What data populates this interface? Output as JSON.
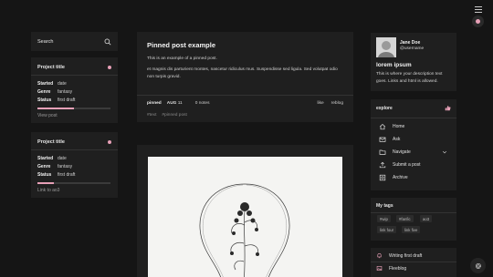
{
  "search": {
    "label": "Search"
  },
  "wips": [
    {
      "title": "Project title",
      "rows": [
        {
          "key": "Started",
          "value": "date"
        },
        {
          "key": "Genre",
          "value": "fantasy"
        },
        {
          "key": "Status",
          "value": "first draft"
        }
      ],
      "progress": 0.5,
      "link": "View post"
    },
    {
      "title": "Project title",
      "rows": [
        {
          "key": "Started",
          "value": "date"
        },
        {
          "key": "Genre",
          "value": "fantasy"
        },
        {
          "key": "Status",
          "value": "first draft"
        }
      ],
      "progress": 0.22,
      "link": "Link to ao3"
    }
  ],
  "post": {
    "title": "Pinned post example",
    "paragraph1": "This is an example of a pinned post.",
    "paragraph2": "et magnis dis parturient montes, nascetur ridiculus mus. Suspendisse sed ligula. Sed volutpat odio non turpis gravid.",
    "pinned": "pinned",
    "date_month": "AUG",
    "date_day": "11",
    "notes": "0 notes",
    "like": "like",
    "reblog": "reblog",
    "tags": [
      "#text",
      "#pinned post"
    ]
  },
  "profile": {
    "name": "Jane Doe",
    "username": "@username",
    "desc_title": "lorem ipsum",
    "desc": "This is where your description text goes. Links and html is allowed."
  },
  "explore": {
    "title": "explore",
    "items": [
      {
        "label": "Home",
        "icon": "home-icon"
      },
      {
        "label": "Ask",
        "icon": "mail-icon"
      },
      {
        "label": "Navigate",
        "icon": "folder-icon"
      },
      {
        "label": "Submit a post",
        "icon": "upload-icon"
      },
      {
        "label": "Archive",
        "icon": "archive-icon"
      }
    ]
  },
  "tags": {
    "title": "My tags",
    "chips": [
      "#wip",
      "#fanfic",
      "ao3",
      "link four",
      "link five"
    ]
  },
  "links": [
    {
      "label": "Writing first draft",
      "icon": "bell-icon"
    },
    {
      "label": "Fleeblog",
      "icon": "image-icon"
    }
  ],
  "colors": {
    "accent": "#e7a0b7",
    "panel": "#1f1f1f",
    "background": "#151515"
  }
}
